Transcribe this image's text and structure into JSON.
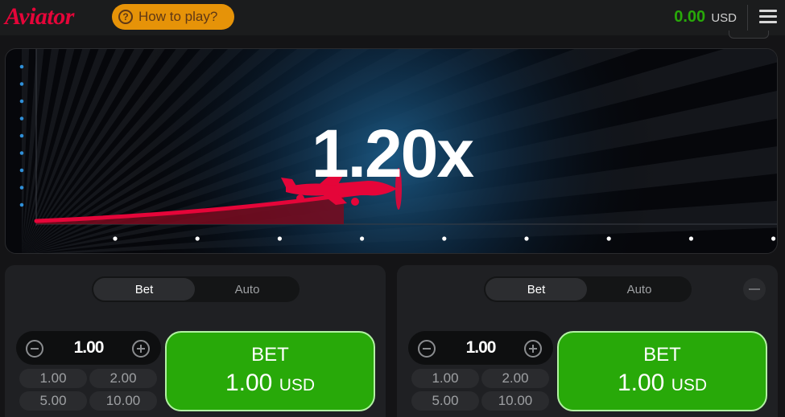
{
  "header": {
    "logo": "Aviator",
    "how_to_play": "How to play?",
    "balance_amount": "0.00",
    "balance_currency": "USD"
  },
  "game": {
    "multiplier": "1.20x"
  },
  "panels": [
    {
      "tabs": [
        "Bet",
        "Auto"
      ],
      "stake": "1.00",
      "quick_bets": [
        "1.00",
        "2.00",
        "5.00",
        "10.00"
      ],
      "button_line1": "BET",
      "button_amount": "1.00",
      "button_currency": "USD"
    },
    {
      "tabs": [
        "Bet",
        "Auto"
      ],
      "stake": "1.00",
      "quick_bets": [
        "1.00",
        "2.00",
        "5.00",
        "10.00"
      ],
      "button_line1": "BET",
      "button_amount": "1.00",
      "button_currency": "USD"
    }
  ],
  "colors": {
    "brand": "#e50539",
    "accent": "#e69308",
    "bet_green": "#28a909",
    "balance_green": "#28a909"
  },
  "icons": [
    "question-icon",
    "menu-icon",
    "minus-icon",
    "plus-icon",
    "plane-icon"
  ]
}
